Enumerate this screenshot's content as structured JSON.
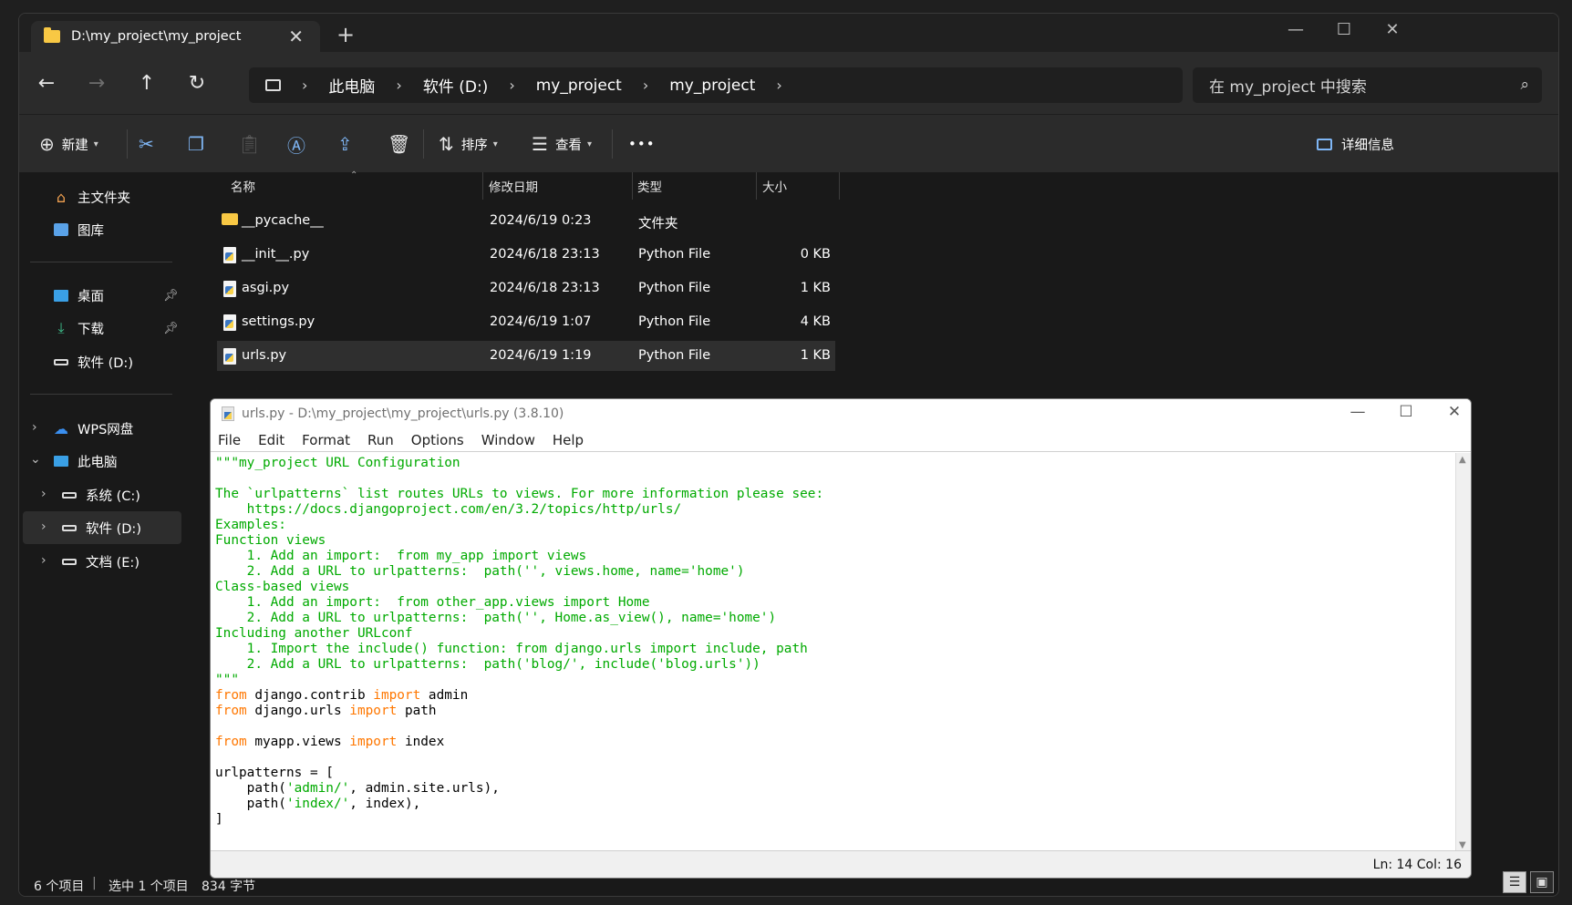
{
  "explorer": {
    "tab_title": "D:\\my_project\\my_project",
    "new_tab": "+",
    "tab_close": "✕",
    "window": {
      "minimize": "—",
      "maximize": "☐",
      "close": "✕"
    },
    "nav": {
      "back": "←",
      "forward": "→",
      "up": "↑",
      "refresh": "↻"
    },
    "breadcrumb": [
      "此电脑",
      "软件 (D:)",
      "my_project",
      "my_project"
    ],
    "search_placeholder": "在 my_project 中搜索",
    "toolbar": {
      "new": "新建",
      "sort": "排序",
      "view": "查看",
      "more": "•••",
      "details": "详细信息"
    },
    "sidebar": {
      "home": "主文件夹",
      "gallery": "图库",
      "desktop": "桌面",
      "downloads": "下载",
      "drive_d_pinned": "软件 (D:)",
      "wps": "WPS网盘",
      "this_pc": "此电脑",
      "drive_c": "系统 (C:)",
      "drive_d": "软件 (D:)",
      "drive_e": "文档 (E:)"
    },
    "columns": {
      "name": "名称",
      "modified": "修改日期",
      "type": "类型",
      "size": "大小"
    },
    "files": [
      {
        "name": "__pycache__",
        "modified": "2024/6/19 0:23",
        "type": "文件夹",
        "size": "",
        "kind": "folder"
      },
      {
        "name": "__init__.py",
        "modified": "2024/6/18 23:13",
        "type": "Python File",
        "size": "0 KB",
        "kind": "python"
      },
      {
        "name": "asgi.py",
        "modified": "2024/6/18 23:13",
        "type": "Python File",
        "size": "1 KB",
        "kind": "python"
      },
      {
        "name": "settings.py",
        "modified": "2024/6/19 1:07",
        "type": "Python File",
        "size": "4 KB",
        "kind": "python"
      },
      {
        "name": "urls.py",
        "modified": "2024/6/19 1:19",
        "type": "Python File",
        "size": "1 KB",
        "kind": "python",
        "selected": true
      }
    ],
    "status": {
      "count": "6 个项目",
      "selected": "选中 1 个项目",
      "size": "834 字节"
    }
  },
  "idle": {
    "title": "urls.py - D:\\my_project\\my_project\\urls.py (3.8.10)",
    "menu": [
      "File",
      "Edit",
      "Format",
      "Run",
      "Options",
      "Window",
      "Help"
    ],
    "code_lines": [
      "\"\"\"my_project URL Configuration",
      "",
      "The `urlpatterns` list routes URLs to views. For more information please see:",
      "    https://docs.djangoproject.com/en/3.2/topics/http/urls/",
      "Examples:",
      "Function views",
      "    1. Add an import:  from my_app import views",
      "    2. Add a URL to urlpatterns:  path('', views.home, name='home')",
      "Class-based views",
      "    1. Add an import:  from other_app.views import Home",
      "    2. Add a URL to urlpatterns:  path('', Home.as_view(), name='home')",
      "Including another URLconf",
      "    1. Import the include() function: from django.urls import include, path",
      "    2. Add a URL to urlpatterns:  path('blog/', include('blog.urls'))",
      "\"\"\"",
      "from django.contrib import admin",
      "from django.urls import path",
      "",
      "from myapp.views import index",
      "",
      "urlpatterns = [",
      "    path('admin/', admin.site.urls),",
      "    path('index/', index),",
      "]"
    ],
    "status": "Ln: 14  Col: 16",
    "window": {
      "minimize": "—",
      "maximize": "☐",
      "close": "✕"
    }
  },
  "colors": {
    "string": "#00aa00",
    "keyword": "#ff7700",
    "accent": "#7fb6f5",
    "folder": "#f8c844"
  }
}
